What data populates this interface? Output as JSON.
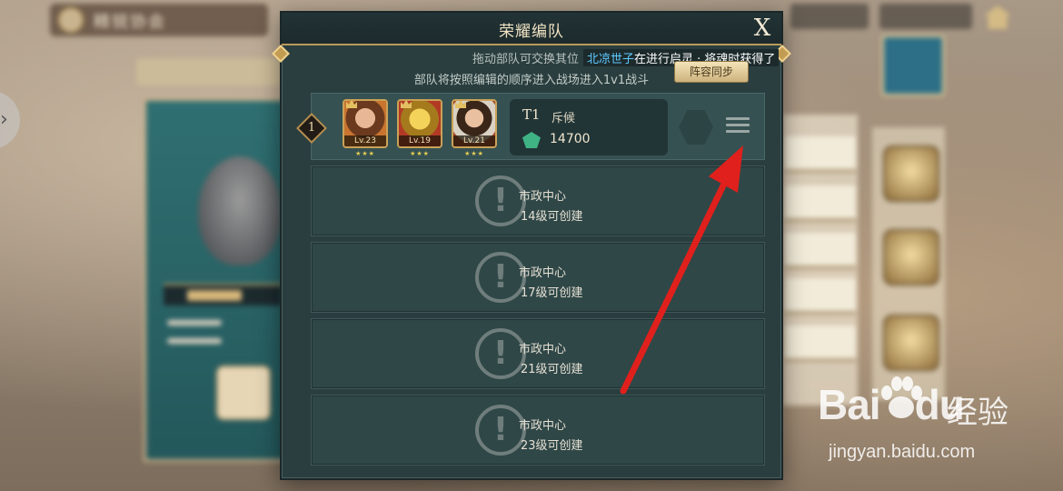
{
  "background": {
    "top_label": "精锐协会",
    "nav_arrow": "›"
  },
  "dialog": {
    "title": "荣耀编队",
    "close_label": "X",
    "marquee_hint": "拖动部队可交换其位",
    "marquee_message_name": "北凉世子",
    "marquee_message_text": "在进行启灵 · 将魂时获得了",
    "instruction": "部队将按照编辑的顺序进入战场进入1v1战斗",
    "sync_button": "阵容同步"
  },
  "team": {
    "index": "1",
    "heroes": [
      {
        "level": "Lv.23",
        "name": "hero-1"
      },
      {
        "level": "Lv.19",
        "name": "hero-2"
      },
      {
        "level": "Lv.21",
        "name": "hero-3"
      }
    ],
    "code": "T1",
    "role": "斥候",
    "power": "14700"
  },
  "locked_slots": [
    {
      "title": "市政中心",
      "requirement": "14级可创建"
    },
    {
      "title": "市政中心",
      "requirement": "17级可创建"
    },
    {
      "title": "市政中心",
      "requirement": "21级可创建"
    },
    {
      "title": "市政中心",
      "requirement": "23级可创建"
    }
  ],
  "watermark": {
    "brand": "Bai",
    "brand2": "du",
    "cn": "经验",
    "url": "jingyan.baidu.com"
  },
  "colors": {
    "annotation": "#e0201c",
    "accent_gold": "#c29c53",
    "name_highlight": "#5fc9ff",
    "panel": "#2a3e3f"
  }
}
